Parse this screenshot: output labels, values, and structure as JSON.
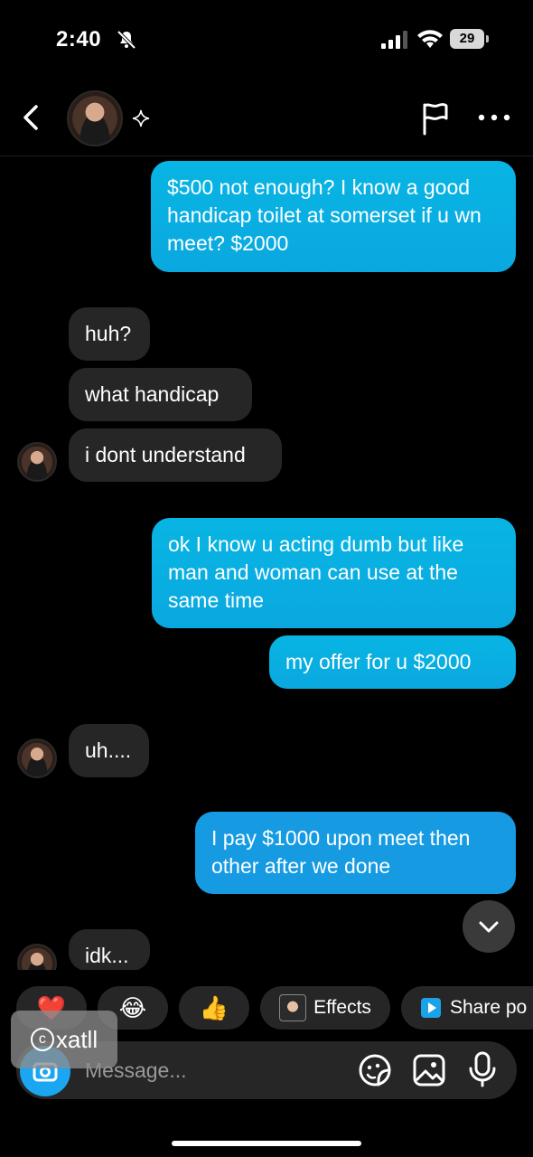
{
  "status_bar": {
    "time": "2:40",
    "battery": "29"
  },
  "header": {
    "icons": [
      "back-arrow",
      "avatar",
      "sparkle",
      "flag",
      "more-dots"
    ]
  },
  "messages": [
    {
      "from": "me",
      "text": "$500 not enough? I know a good handicap toilet at somerset if u wn meet? $2000"
    },
    {
      "from": "them",
      "text": "huh?"
    },
    {
      "from": "them",
      "text": "what handicap"
    },
    {
      "from": "them",
      "text": "i dont understand"
    },
    {
      "from": "me",
      "text": "ok I know u acting dumb but like man and woman can use at the same time"
    },
    {
      "from": "me",
      "text": "my offer for u $2000"
    },
    {
      "from": "them",
      "text": "uh...."
    },
    {
      "from": "me",
      "text": "I pay $1000 upon meet then other after we done"
    },
    {
      "from": "them",
      "text": "idk..."
    }
  ],
  "quick_reactions": {
    "heart": "❤️",
    "laugh": "😂",
    "thumbs_up": "👍",
    "effects_label": "Effects",
    "share_label": "Share po"
  },
  "composer": {
    "placeholder": "Message..."
  },
  "watermark": {
    "text": "xatll",
    "symbol": "c"
  },
  "colors": {
    "sent_bubble": "#0aafe2",
    "received_bubble": "#262626",
    "background": "#000000",
    "accent": "#1aa6f0"
  }
}
